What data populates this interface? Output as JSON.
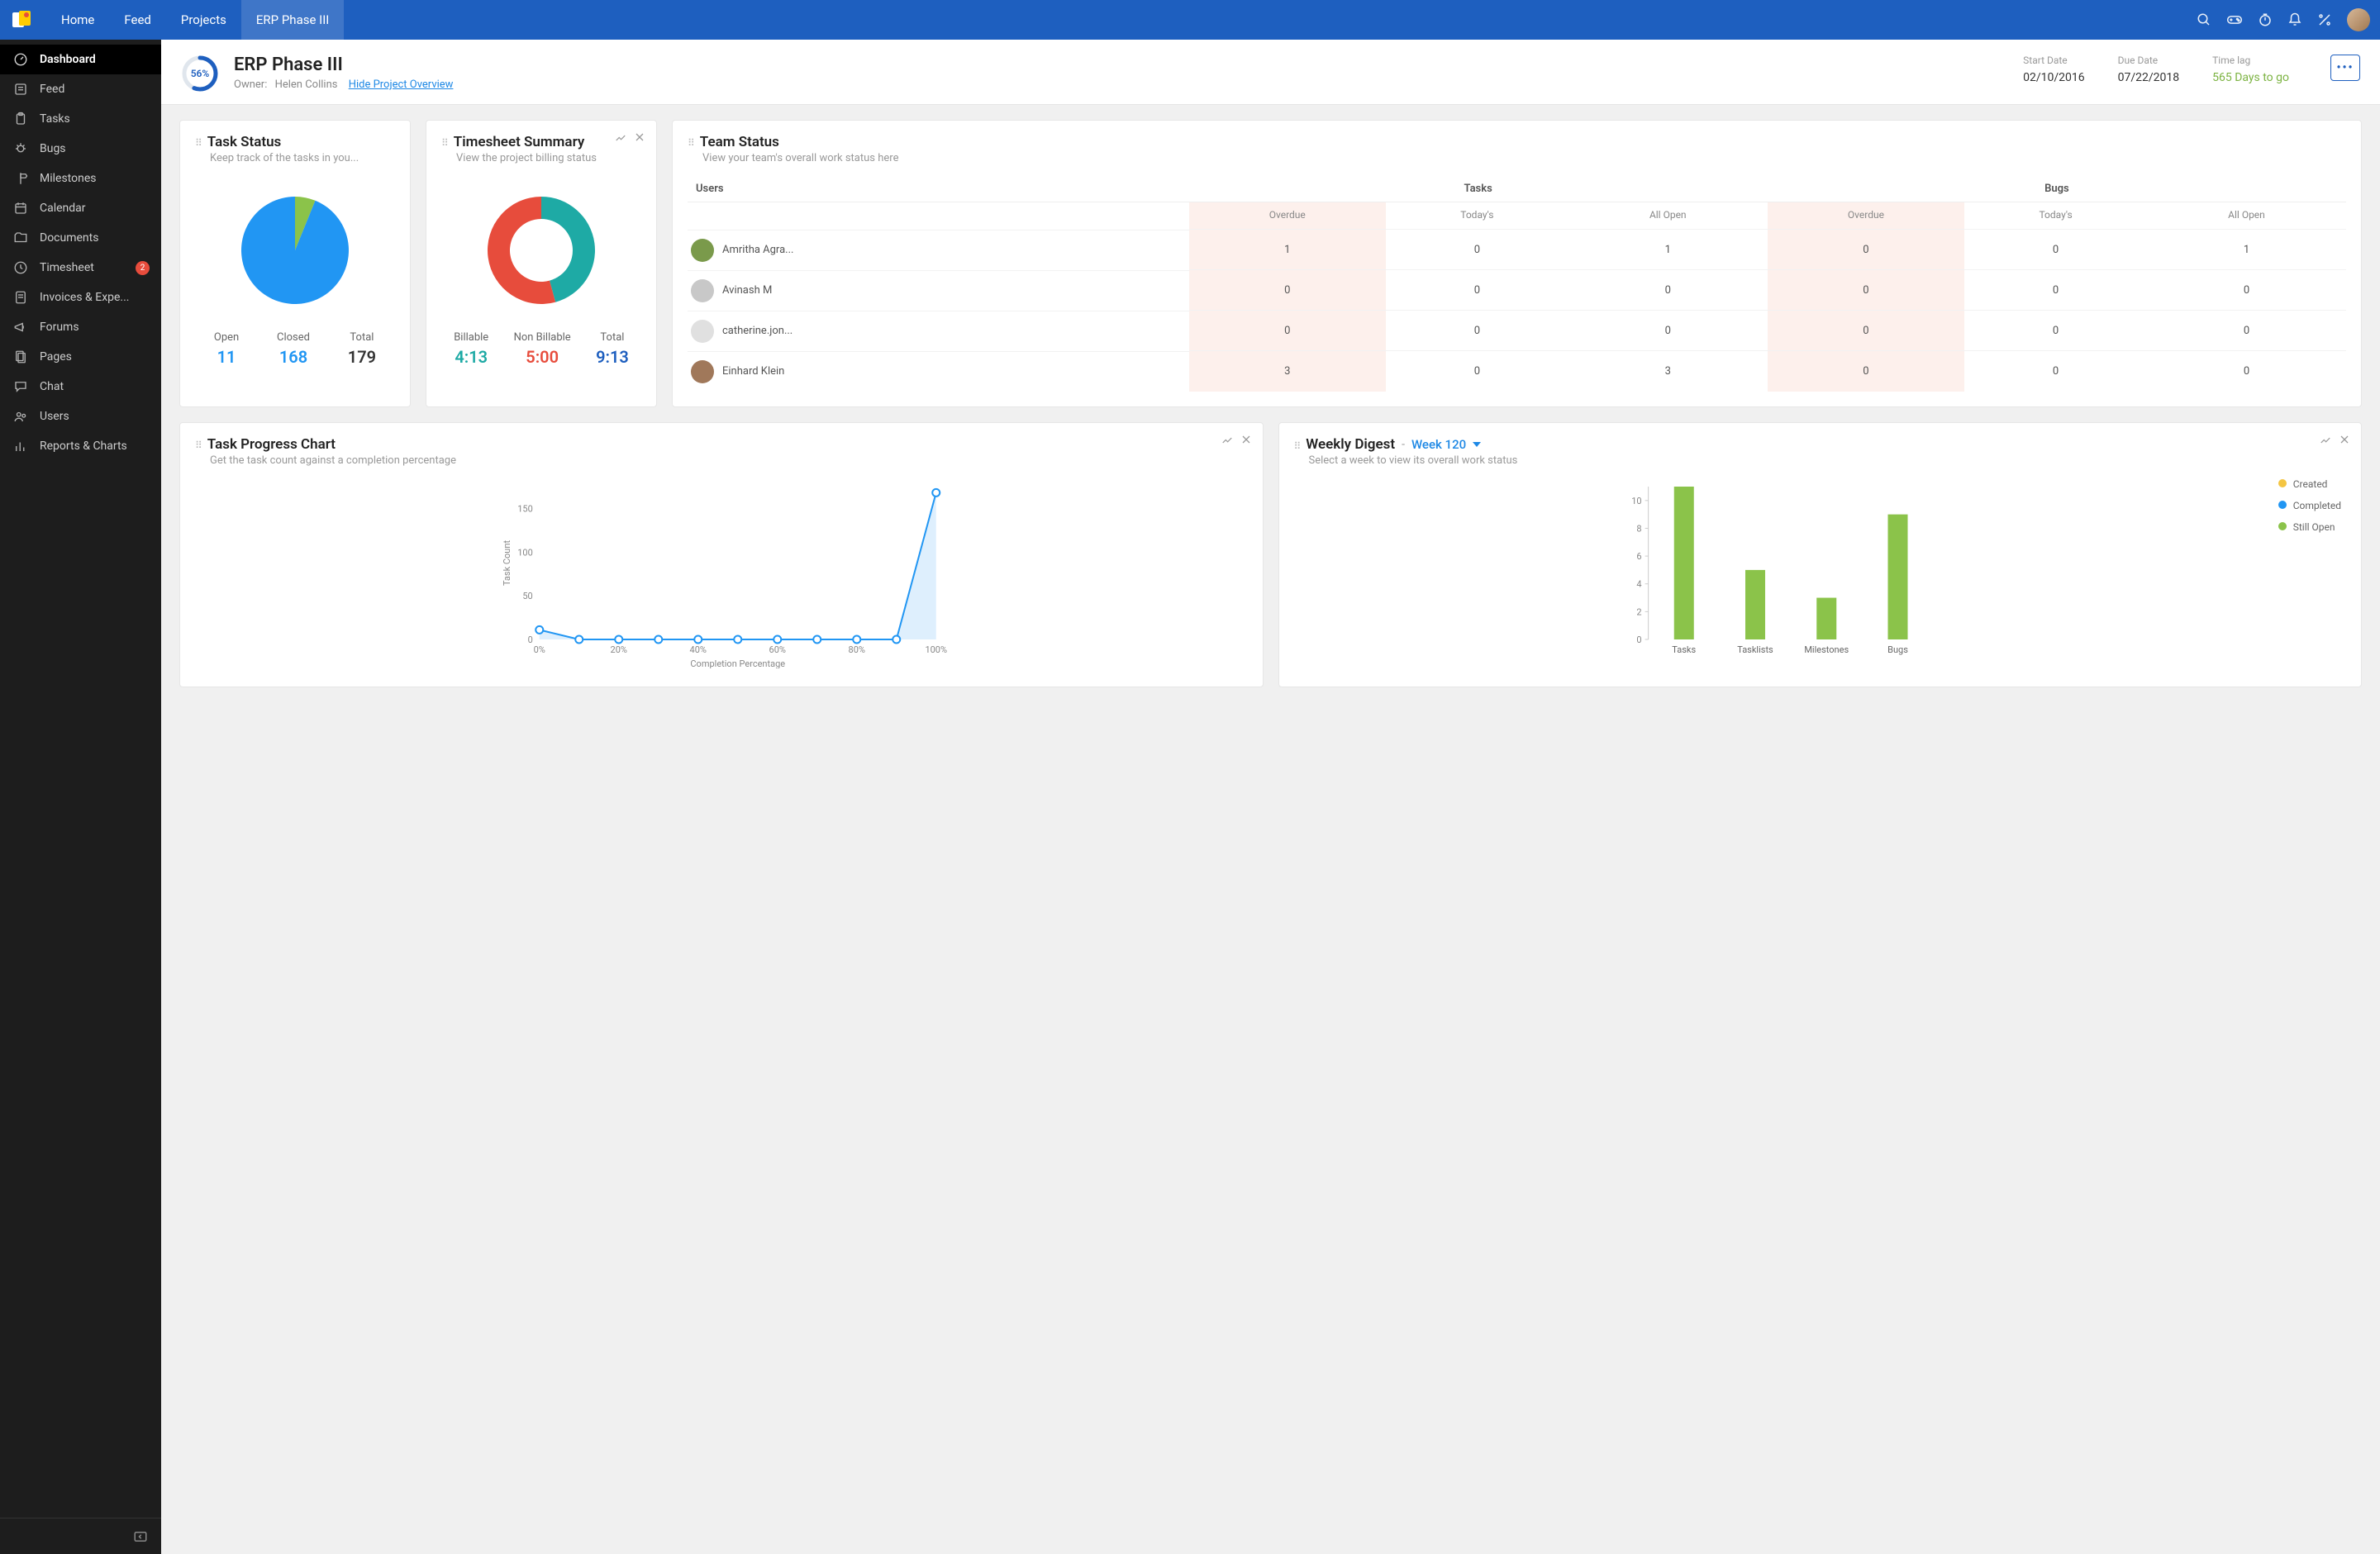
{
  "nav": {
    "items": [
      "Home",
      "Feed",
      "Projects"
    ],
    "active_project": "ERP Phase III"
  },
  "sidebar": {
    "items": [
      {
        "label": "Dashboard",
        "icon": "gauge"
      },
      {
        "label": "Feed",
        "icon": "feed"
      },
      {
        "label": "Tasks",
        "icon": "clipboard"
      },
      {
        "label": "Bugs",
        "icon": "bug"
      },
      {
        "label": "Milestones",
        "icon": "signpost"
      },
      {
        "label": "Calendar",
        "icon": "calendar"
      },
      {
        "label": "Documents",
        "icon": "folder"
      },
      {
        "label": "Timesheet",
        "icon": "clock",
        "badge": "2"
      },
      {
        "label": "Invoices & Expe...",
        "icon": "invoice"
      },
      {
        "label": "Forums",
        "icon": "megaphone"
      },
      {
        "label": "Pages",
        "icon": "pages"
      },
      {
        "label": "Chat",
        "icon": "chat"
      },
      {
        "label": "Users",
        "icon": "users"
      },
      {
        "label": "Reports & Charts",
        "icon": "barchart"
      }
    ]
  },
  "project": {
    "title": "ERP Phase III",
    "percent": "56%",
    "percent_num": 56,
    "owner_label": "Owner:",
    "owner_name": "Helen Collins",
    "overview_link": "Hide Project Overview",
    "start_label": "Start Date",
    "start_value": "02/10/2016",
    "due_label": "Due Date",
    "due_value": "07/22/2018",
    "lag_label": "Time lag",
    "lag_value": "565 Days to go"
  },
  "task_status": {
    "title": "Task Status",
    "subtitle": "Keep track of the tasks in you...",
    "open_label": "Open",
    "open_value": "11",
    "closed_label": "Closed",
    "closed_value": "168",
    "total_label": "Total",
    "total_value": "179"
  },
  "timesheet": {
    "title": "Timesheet Summary",
    "subtitle": "View the project billing status",
    "billable_label": "Billable",
    "billable_value": "4:13",
    "nonbillable_label": "Non Billable",
    "nonbillable_value": "5:00",
    "total_label": "Total",
    "total_value": "9:13"
  },
  "team_status": {
    "title": "Team Status",
    "subtitle": "View your team's overall work status here",
    "col_users": "Users",
    "col_tasks": "Tasks",
    "col_bugs": "Bugs",
    "sub_overdue": "Overdue",
    "sub_todays": "Today's",
    "sub_allopen": "All Open",
    "rows": [
      {
        "name": "Amritha Agra...",
        "t_over": "1",
        "t_today": "0",
        "t_open": "1",
        "b_over": "0",
        "b_today": "0",
        "b_open": "1"
      },
      {
        "name": "Avinash M",
        "t_over": "0",
        "t_today": "0",
        "t_open": "0",
        "b_over": "0",
        "b_today": "0",
        "b_open": "0"
      },
      {
        "name": "catherine.jon...",
        "t_over": "0",
        "t_today": "0",
        "t_open": "0",
        "b_over": "0",
        "b_today": "0",
        "b_open": "0"
      },
      {
        "name": "Einhard Klein",
        "t_over": "3",
        "t_today": "0",
        "t_open": "3",
        "b_over": "0",
        "b_today": "0",
        "b_open": "0"
      }
    ]
  },
  "task_progress": {
    "title": "Task Progress Chart",
    "subtitle": "Get the task count against a completion percentage"
  },
  "weekly_digest": {
    "title": "Weekly Digest",
    "week": "Week 120",
    "subtitle": "Select a week to view its overall work status",
    "legend": [
      {
        "label": "Created",
        "color": "#f4c542"
      },
      {
        "label": "Completed",
        "color": "#2196f3"
      },
      {
        "label": "Still Open",
        "color": "#8bc34a"
      }
    ]
  },
  "chart_data": [
    {
      "id": "task_status_pie",
      "type": "pie",
      "title": "Task Status",
      "series": [
        {
          "name": "Open",
          "value": 11,
          "color": "#8bc34a"
        },
        {
          "name": "Closed",
          "value": 168,
          "color": "#2196f3"
        }
      ],
      "total": 179
    },
    {
      "id": "timesheet_donut",
      "type": "pie",
      "title": "Timesheet Summary",
      "series": [
        {
          "name": "Billable",
          "value": 253,
          "display": "4:13",
          "color": "#1eaaa5"
        },
        {
          "name": "Non Billable",
          "value": 300,
          "display": "5:00",
          "color": "#e74c3c"
        }
      ],
      "total_display": "9:13",
      "donut": true
    },
    {
      "id": "task_progress_line",
      "type": "line",
      "title": "Task Progress Chart",
      "xlabel": "Completion Percentage",
      "ylabel": "Task Count",
      "x": [
        0,
        10,
        20,
        30,
        40,
        50,
        60,
        70,
        80,
        90,
        100
      ],
      "y": [
        11,
        0,
        0,
        0,
        0,
        0,
        0,
        0,
        0,
        0,
        168
      ],
      "x_ticks": [
        "0%",
        "20%",
        "40%",
        "60%",
        "80%",
        "100%"
      ],
      "y_ticks": [
        0,
        50,
        100,
        150
      ],
      "ylim": [
        0,
        175
      ],
      "color": "#2196f3"
    },
    {
      "id": "weekly_digest_bar",
      "type": "bar",
      "title": "Weekly Digest",
      "categories": [
        "Tasks",
        "Tasklists",
        "Milestones",
        "Bugs"
      ],
      "series": [
        {
          "name": "Still Open",
          "color": "#8bc34a",
          "values": [
            11,
            5,
            3,
            9
          ]
        }
      ],
      "y_ticks": [
        0,
        2,
        4,
        6,
        8,
        10
      ],
      "ylim": [
        0,
        11
      ]
    }
  ]
}
